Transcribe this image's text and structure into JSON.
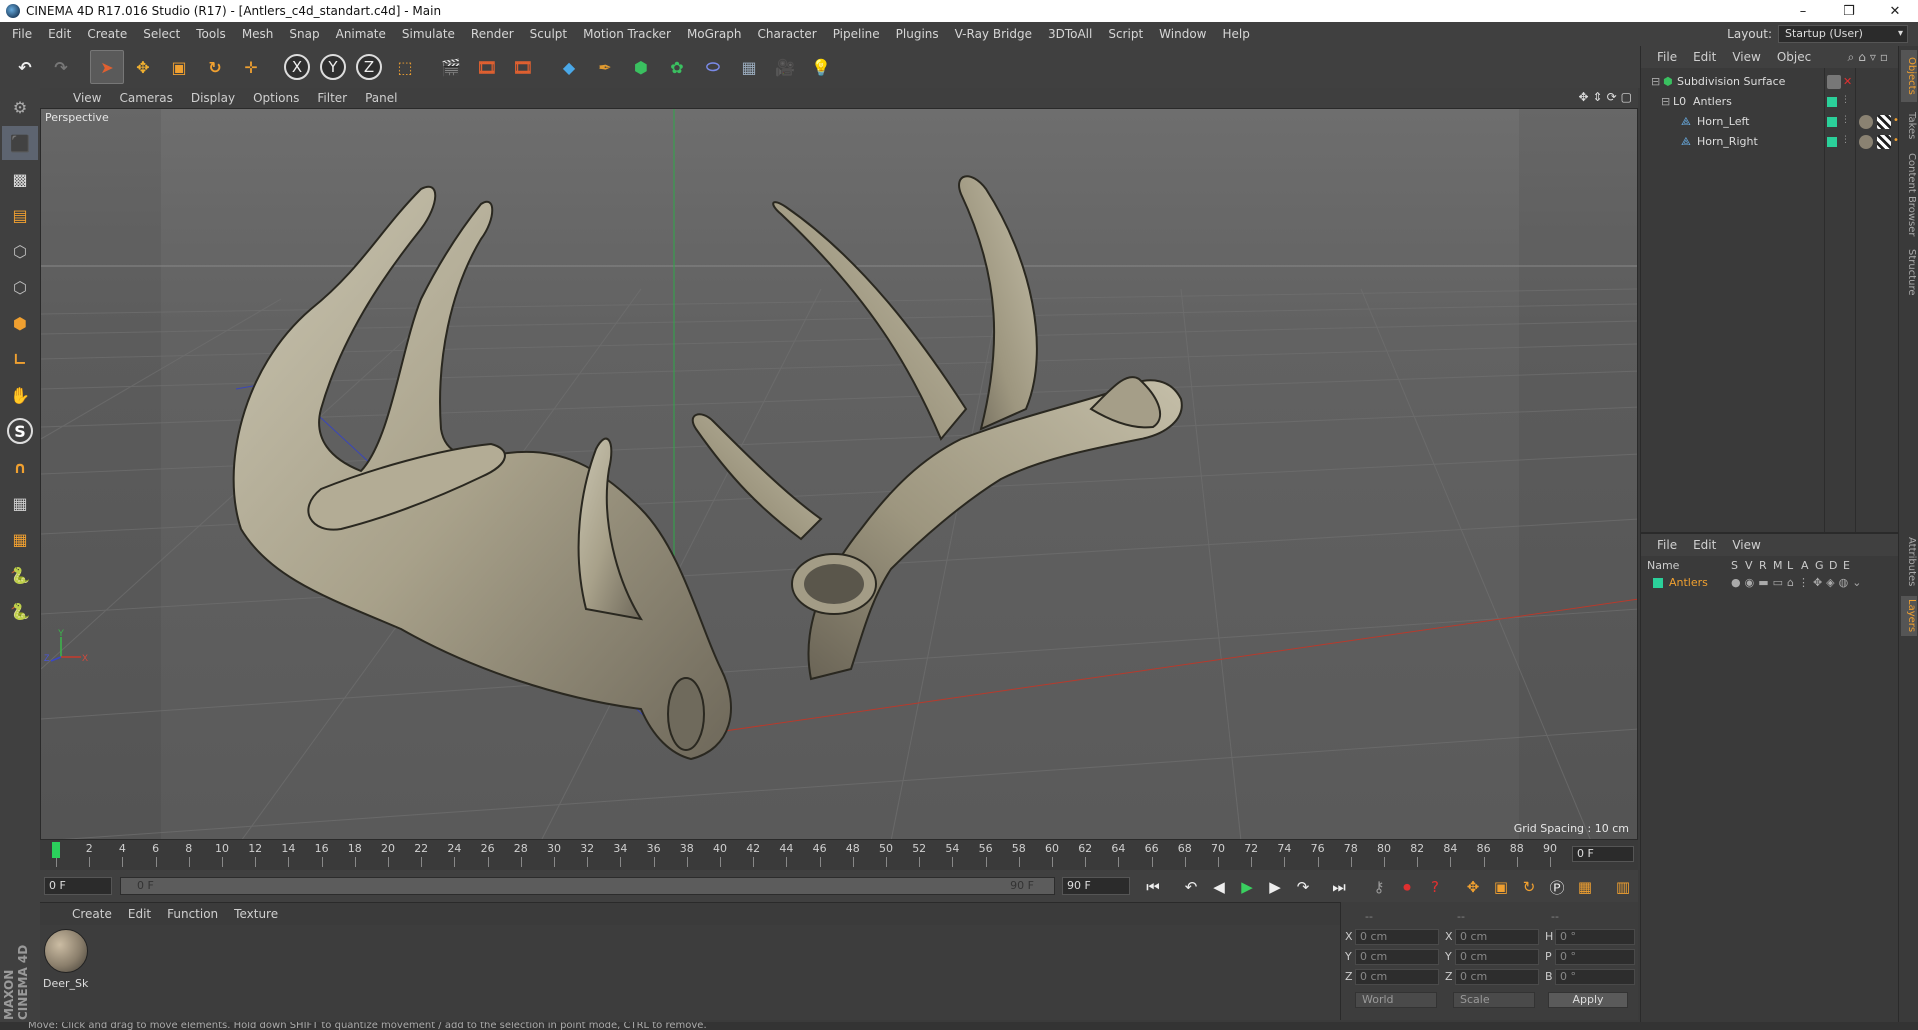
{
  "window": {
    "title": "CINEMA 4D R17.016 Studio (R17) - [Antlers_c4d_standart.c4d] - Main",
    "minimize": "–",
    "restore": "❒",
    "close": "✕"
  },
  "menubar": [
    "File",
    "Edit",
    "Create",
    "Select",
    "Tools",
    "Mesh",
    "Snap",
    "Animate",
    "Simulate",
    "Render",
    "Sculpt",
    "Motion Tracker",
    "MoGraph",
    "Character",
    "Pipeline",
    "Plugins",
    "V-Ray Bridge",
    "3DToAll",
    "Script",
    "Window",
    "Help"
  ],
  "layout": {
    "label": "Layout:",
    "value": "Startup (User)"
  },
  "toolbar": {
    "axes": [
      "X",
      "Y",
      "Z"
    ]
  },
  "viewport": {
    "menu": [
      "View",
      "Cameras",
      "Display",
      "Options",
      "Filter",
      "Panel"
    ],
    "camera_label": "Perspective",
    "grid_spacing": "Grid Spacing : 10 cm",
    "axis_labels": {
      "y": "Y",
      "z": "Z",
      "x": "X"
    }
  },
  "timeline": {
    "ticks": [
      "0",
      "2",
      "4",
      "6",
      "8",
      "10",
      "12",
      "14",
      "16",
      "18",
      "20",
      "22",
      "24",
      "26",
      "28",
      "30",
      "32",
      "34",
      "36",
      "38",
      "40",
      "42",
      "44",
      "46",
      "48",
      "50",
      "52",
      "54",
      "56",
      "58",
      "60",
      "62",
      "64",
      "66",
      "68",
      "70",
      "72",
      "74",
      "76",
      "78",
      "80",
      "82",
      "84",
      "86",
      "88",
      "90"
    ],
    "current_frame": "0 F"
  },
  "playback": {
    "start_field": "0 F",
    "slider_start": "0 F",
    "slider_end": "90 F",
    "end_field": "90 F"
  },
  "material_panel": {
    "menu": [
      "Create",
      "Edit",
      "Function",
      "Texture"
    ],
    "material_name": "Deer_Sk"
  },
  "coords": {
    "header": [
      "--",
      "--",
      "--"
    ],
    "rows": [
      {
        "l1": "X",
        "v1": "0 cm",
        "l2": "X",
        "v2": "0 cm",
        "l3": "H",
        "v3": "0 °"
      },
      {
        "l1": "Y",
        "v1": "0 cm",
        "l2": "Y",
        "v2": "0 cm",
        "l3": "P",
        "v3": "0 °"
      },
      {
        "l1": "Z",
        "v1": "0 cm",
        "l2": "Z",
        "v2": "0 cm",
        "l3": "B",
        "v3": "0 °"
      }
    ],
    "space": "World",
    "mode": "Scale",
    "apply": "Apply"
  },
  "objects_panel": {
    "menu": [
      "File",
      "Edit",
      "View",
      "Objec"
    ],
    "items": [
      "Subdivision Surface",
      "Antlers",
      "Horn_Left",
      "Horn_Right"
    ]
  },
  "layers_panel": {
    "menu": [
      "File",
      "Edit",
      "View"
    ],
    "columns": [
      "Name",
      "S",
      "V",
      "R",
      "M",
      "L",
      "A",
      "G",
      "D",
      "E"
    ],
    "layer_name": "Antlers"
  },
  "side_tabs": [
    "Objects",
    "Takes",
    "Content Browser",
    "Structure",
    "Attributes",
    "Layers"
  ],
  "status": "Move: Click and drag to move elements. Hold down SHIFT to quantize movement / add to the selection in point mode, CTRL to remove.",
  "brand": "MAXON CINEMA 4D",
  "colors": {
    "accent": "#f0a030",
    "layer_green": "#2bd09a",
    "frame_green": "#2bd05c"
  }
}
